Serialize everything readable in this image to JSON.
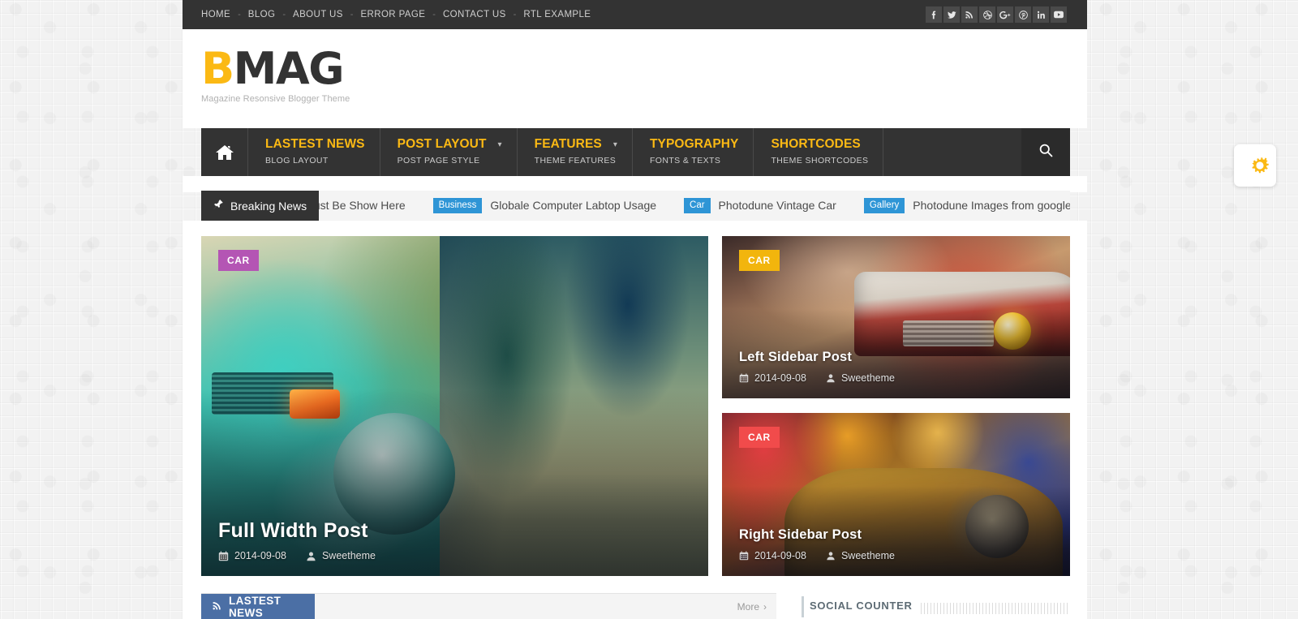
{
  "topbar": {
    "nav": [
      {
        "label": "HOME"
      },
      {
        "label": "BLOG"
      },
      {
        "label": "ABOUT US"
      },
      {
        "label": "ERROR PAGE"
      },
      {
        "label": "CONTACT US"
      },
      {
        "label": "RTL EXAMPLE"
      }
    ],
    "separator": "-",
    "social": [
      {
        "name": "facebook-icon",
        "glyph": "f"
      },
      {
        "name": "twitter-icon",
        "glyph": "t"
      },
      {
        "name": "rss-icon",
        "glyph": "r"
      },
      {
        "name": "dribbble-icon",
        "glyph": "d"
      },
      {
        "name": "google-plus-icon",
        "glyph": "g+"
      },
      {
        "name": "pinterest-icon",
        "glyph": "p"
      },
      {
        "name": "linkedin-icon",
        "glyph": "in"
      },
      {
        "name": "youtube-icon",
        "glyph": "yt"
      }
    ]
  },
  "header": {
    "logo_b": "B",
    "logo_rest": "MAG",
    "tagline": "Magazine Resonsive Blogger Theme",
    "logo_accent_color": "#fbb914"
  },
  "mainnav": {
    "home_icon": "home-icon",
    "search_icon": "search-icon",
    "items": [
      {
        "title": "LASTEST NEWS",
        "subtitle": "BLOG LAYOUT",
        "has_caret": false
      },
      {
        "title": "POST LAYOUT",
        "subtitle": "POST PAGE STYLE",
        "has_caret": true
      },
      {
        "title": "FEATURES",
        "subtitle": "THEME FEATURES",
        "has_caret": true
      },
      {
        "title": "TYPOGRAPHY",
        "subtitle": "FONTS & TEXTS",
        "has_caret": false
      },
      {
        "title": "SHORTCODES",
        "subtitle": "THEME SHORTCODES",
        "has_caret": false
      }
    ],
    "accent_color": "#fbb914",
    "bg_color": "#333333"
  },
  "breaking": {
    "label": "Breaking News",
    "pin_icon": "pin-icon",
    "items": [
      {
        "category": "",
        "title": "Must Be Show Here"
      },
      {
        "category": "Business",
        "title": "Globale Computer Labtop Usage"
      },
      {
        "category": "Car",
        "title": "Photodune Vintage Car"
      },
      {
        "category": "Gallery",
        "title": "Photodune Images from google search"
      }
    ],
    "category_color": "#2e95d6"
  },
  "featured": {
    "big": {
      "badge": "CAR",
      "badge_color": "#b455b4",
      "title": "Full Width Post",
      "date": "2014-09-08",
      "author": "Sweetheme",
      "calendar_icon": "calendar-icon",
      "author_icon": "user-icon"
    },
    "small": [
      {
        "badge": "CAR",
        "badge_color": "#f2b50d",
        "title": "Left Sidebar Post",
        "date": "2014-09-08",
        "author": "Sweetheme",
        "calendar_icon": "calendar-icon",
        "author_icon": "user-icon"
      },
      {
        "badge": "CAR",
        "badge_color": "#f14b4b",
        "title": "Right Sidebar Post",
        "date": "2014-09-08",
        "author": "Sweetheme",
        "calendar_icon": "calendar-icon",
        "author_icon": "user-icon"
      }
    ]
  },
  "widgets": {
    "left": {
      "tab_label": "LASTEST NEWS",
      "tab_icon": "rss-icon",
      "more_label": "More",
      "more_icon": "chevron-right-icon",
      "tab_color": "#4b6fa5"
    },
    "right": {
      "title": "SOCIAL COUNTER"
    }
  },
  "settings_fab": {
    "icon": "gears-icon",
    "color": "#fbb914"
  }
}
